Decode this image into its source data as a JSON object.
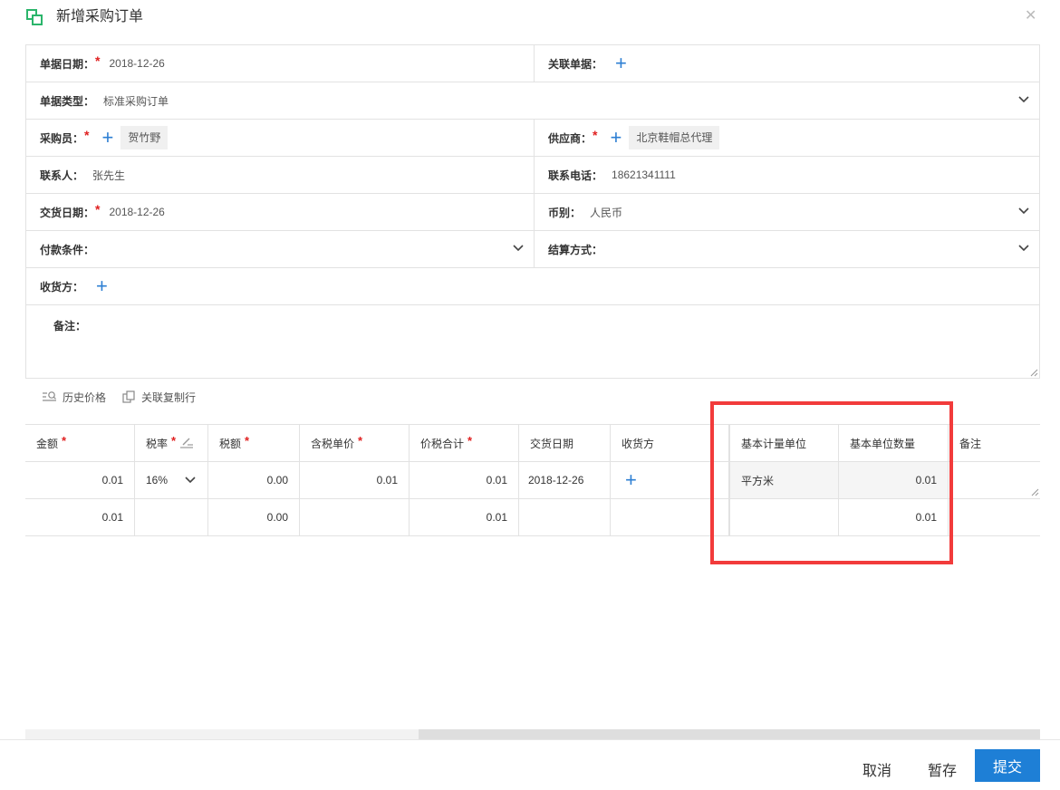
{
  "dialog": {
    "title": "新增采购订单"
  },
  "form": {
    "bill_date": {
      "label": "单据日期：",
      "value": "2018-12-26"
    },
    "related_bill": {
      "label": "关联单据："
    },
    "bill_type": {
      "label": "单据类型：",
      "value": "标准采购订单"
    },
    "buyer": {
      "label": "采购员：",
      "value": "贺竹野"
    },
    "supplier": {
      "label": "供应商：",
      "value": "北京鞋帽总代理"
    },
    "contact": {
      "label": "联系人：",
      "value": "张先生"
    },
    "phone": {
      "label": "联系电话：",
      "value": "18621341111"
    },
    "delivery_date": {
      "label": "交货日期：",
      "value": "2018-12-26"
    },
    "currency": {
      "label": "币别：",
      "value": "人民币"
    },
    "payment_terms": {
      "label": "付款条件："
    },
    "settlement": {
      "label": "结算方式："
    },
    "receiver": {
      "label": "收货方："
    },
    "remark": {
      "label": "备注："
    }
  },
  "toolbar": {
    "history_price": "历史价格",
    "copy_related": "关联复制行"
  },
  "grid": {
    "headers": {
      "amount": "金额",
      "tax_rate": "税率",
      "tax": "税额",
      "unit_price_tax": "含税单价",
      "total_tax": "价税合计",
      "delivery_date": "交货日期",
      "receiver": "收货方",
      "base_unit": "基本计量单位",
      "base_qty": "基本单位数量",
      "remark": "备注"
    },
    "rows": [
      {
        "amount": "0.01",
        "tax_rate": "16%",
        "tax": "0.00",
        "unit_price_tax": "0.01",
        "total_tax": "0.01",
        "delivery_date": "2018-12-26",
        "base_unit": "平方米",
        "base_qty": "0.01"
      }
    ],
    "totals": {
      "amount": "0.01",
      "tax": "0.00",
      "total_tax": "0.01",
      "base_qty": "0.01"
    }
  },
  "footer": {
    "cancel": "取消",
    "save_draft": "暂存",
    "submit": "提交"
  },
  "colors": {
    "accent": "#1e7fd6",
    "required": "#e02020",
    "highlight": "#f23b3b"
  }
}
